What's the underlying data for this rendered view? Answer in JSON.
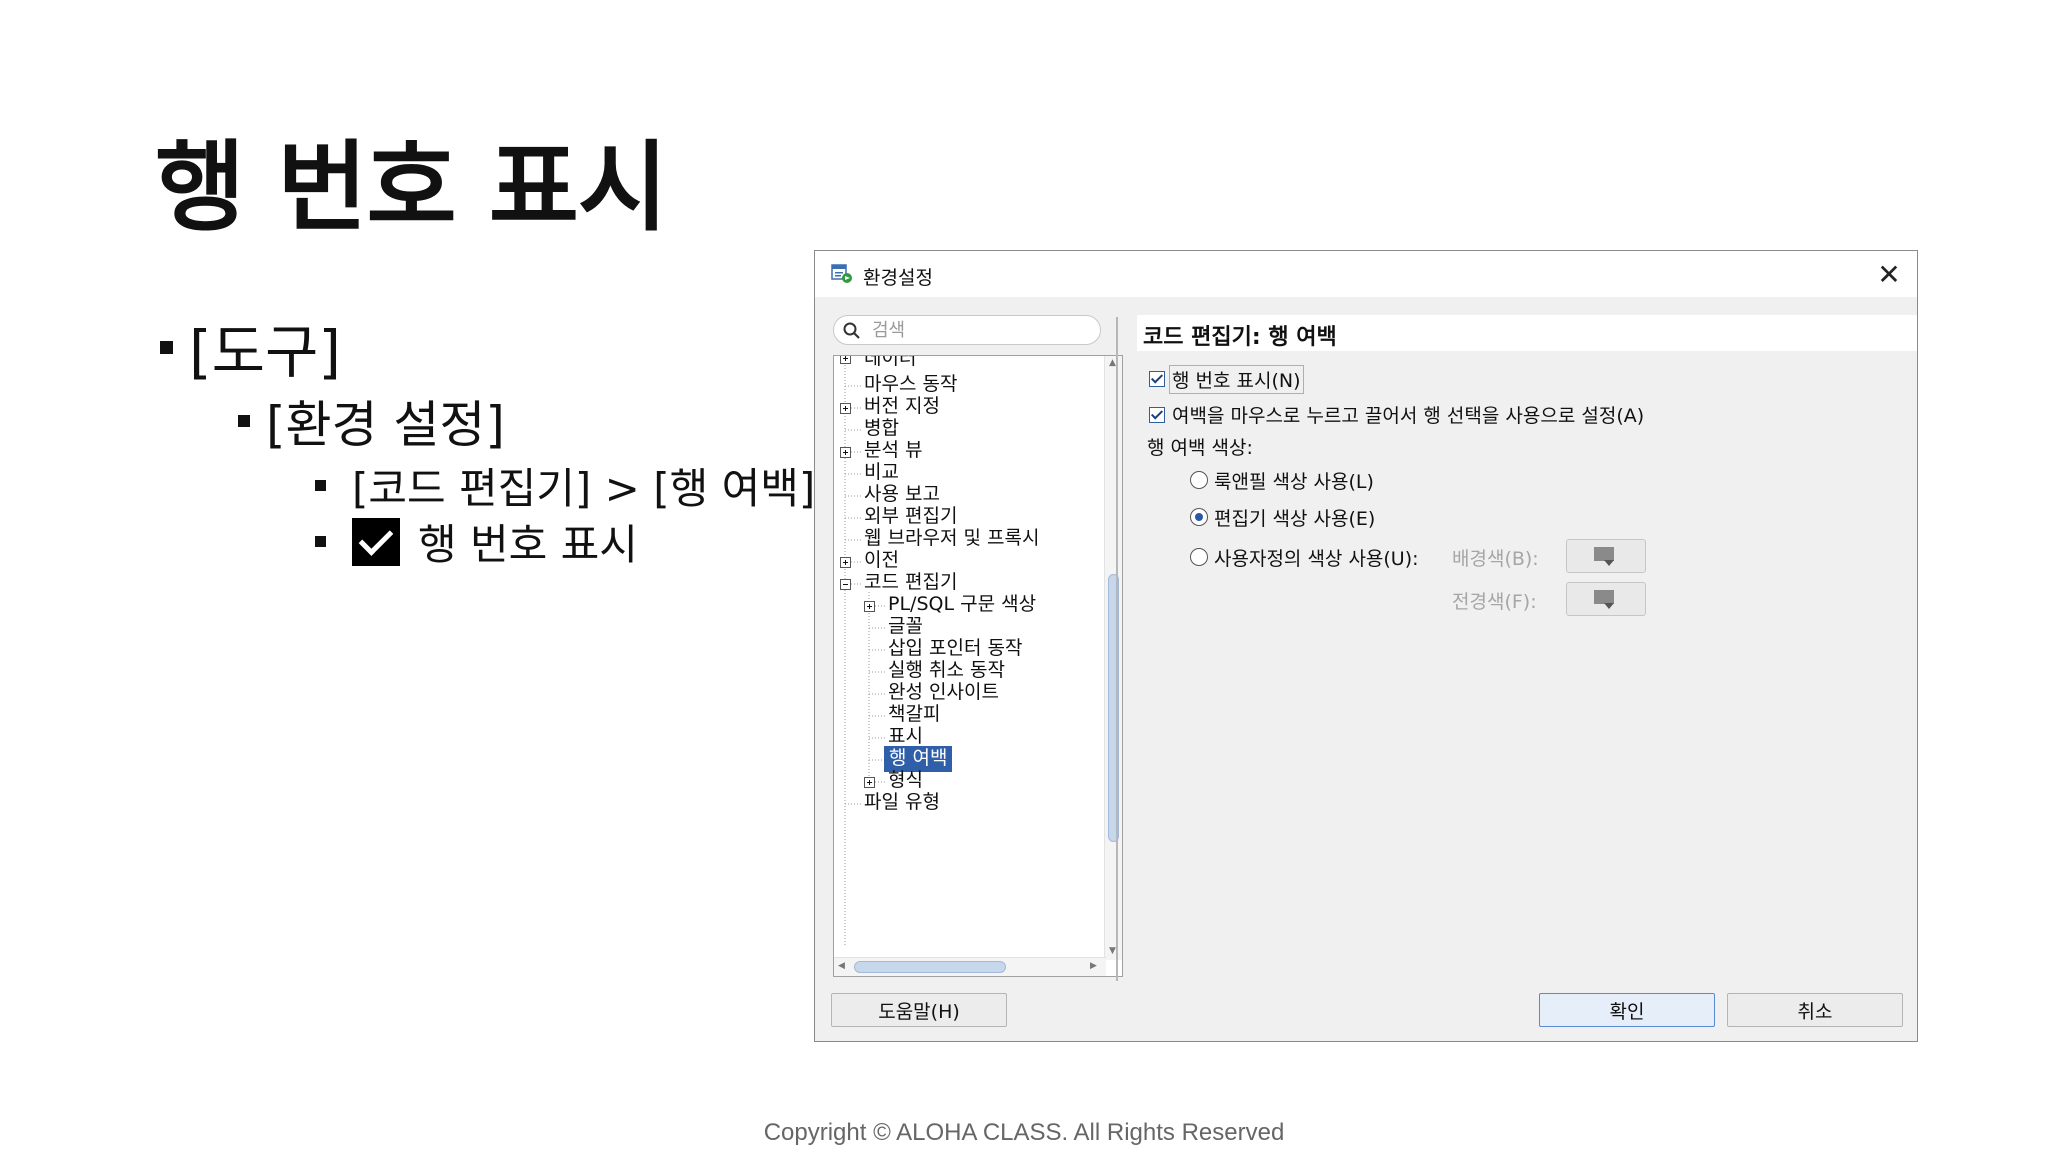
{
  "slide": {
    "title": "행 번호 표시",
    "bullets": [
      "[도구]",
      "[환경 설정]",
      "[코드 편집기] > [행 여백]",
      "행 번호 표시"
    ],
    "footer": "Copyright © ALOHA CLASS. All Rights Reserved"
  },
  "dialog": {
    "title": "환경설정",
    "search_placeholder": "검색",
    "tree_items": [
      "데이터",
      "마우스 동작",
      "버전 지정",
      "병합",
      "분석 뷰",
      "비교",
      "사용 보고",
      "외부 편집기",
      "웹 브라우저 및 프록시",
      "이전",
      "코드 편집기",
      "PL/SQL 구문 색상",
      "글꼴",
      "삽입 포인터 동작",
      "실행 취소 동작",
      "완성 인사이트",
      "책갈피",
      "표시",
      "행 여백",
      "형식",
      "파일 유형"
    ],
    "selected_item": "행 여백",
    "section_title": "코드 편집기: 행 여백",
    "options": {
      "show_line_numbers": "행 번호 표시(N)",
      "drag_select": "여백을 마우스로 누르고 끌어서 행 선택을 사용으로 설정(A)",
      "margin_color_label": "행 여백 색상:",
      "radio_lookandfeel": "룩앤필 색상 사용(L)",
      "radio_editor": "편집기 색상 사용(E)",
      "radio_custom": "사용자정의 색상 사용(U):",
      "background_color": "배경색(B):",
      "foreground_color": "전경색(F):"
    },
    "buttons": {
      "help": "도움말(H)",
      "ok": "확인",
      "cancel": "취소"
    }
  }
}
